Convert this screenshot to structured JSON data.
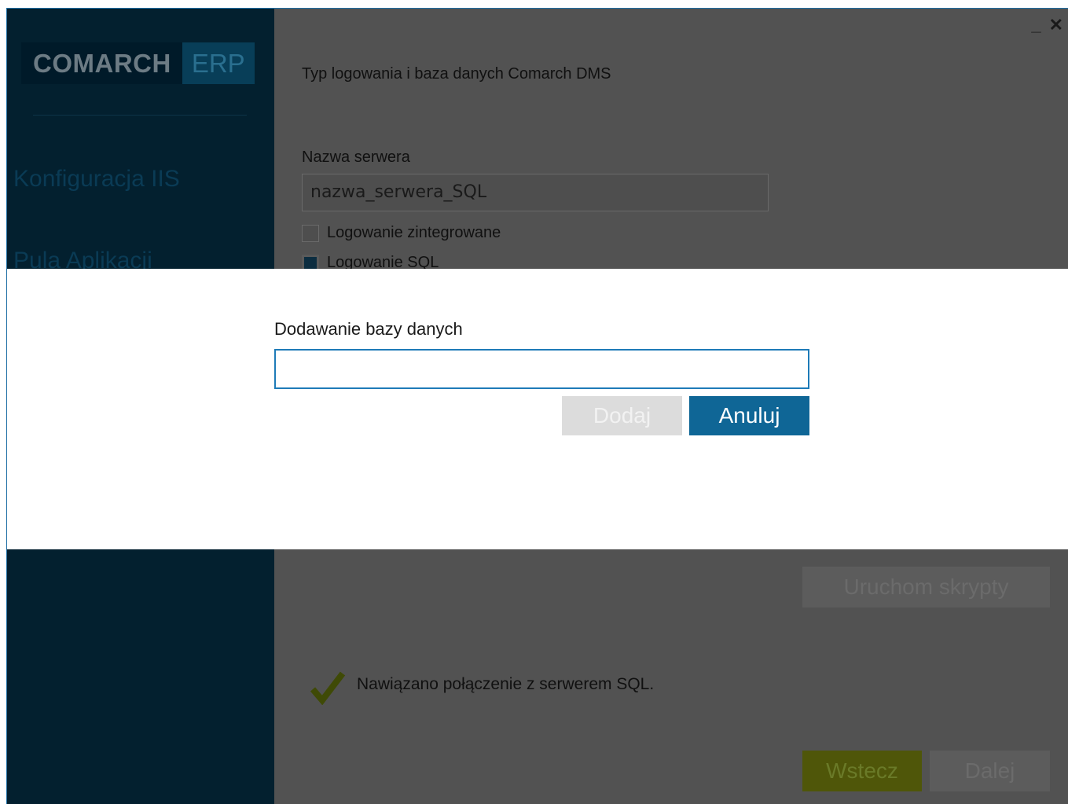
{
  "sidebar": {
    "logo_main": "COMARCH",
    "logo_erp": "ERP",
    "items": [
      {
        "label": "Konfiguracja IIS"
      },
      {
        "label": "Pula Aplikacji"
      }
    ]
  },
  "window_controls": {
    "minimize": "_",
    "close": "✕"
  },
  "main": {
    "title": "Typ logowania i baza danych Comarch DMS",
    "server_label": "Nazwa serwera",
    "server_value": "nazwa_serwera_SQL",
    "checkbox_integrated": {
      "label": "Logowanie zintegrowane",
      "checked": false
    },
    "checkbox_sql": {
      "label": "Logowanie SQL",
      "checked": true
    },
    "run_scripts_label": "Uruchom skrypty",
    "status_text": "Nawiązano połączenie z serwerem SQL.",
    "back_label": "Wstecz",
    "next_label": "Dalej"
  },
  "modal": {
    "title": "Dodawanie bazy danych",
    "input_value": "",
    "add_label": "Dodaj",
    "cancel_label": "Anuluj"
  },
  "colors": {
    "sidebar_bg": "#03202f",
    "content_bg": "#525252",
    "accent_blue": "#0f6696",
    "accent_green": "#4f5609",
    "check_green": "#3f4a06"
  },
  "icons": {
    "status": "checkmark-icon",
    "close": "close-icon",
    "minimize": "minimize-icon"
  }
}
